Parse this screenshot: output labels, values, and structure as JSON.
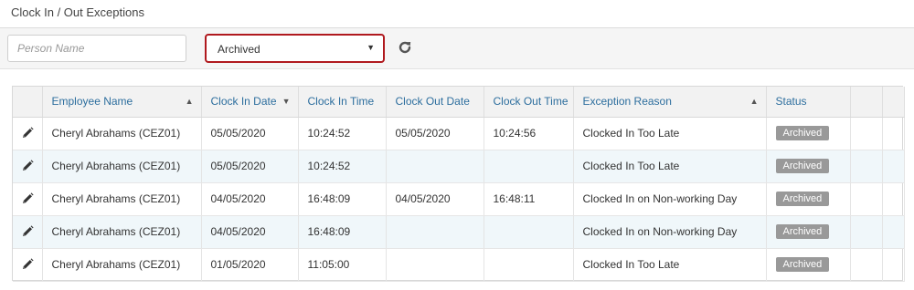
{
  "page": {
    "title": "Clock In / Out Exceptions"
  },
  "filters": {
    "person_placeholder": "Person Name",
    "person_value": "",
    "status_selected": "Archived"
  },
  "table": {
    "columns": [
      {
        "label": "",
        "sort": ""
      },
      {
        "label": "Employee Name",
        "sort": "▲"
      },
      {
        "label": "Clock In Date",
        "sort": "▼"
      },
      {
        "label": "Clock In Time",
        "sort": ""
      },
      {
        "label": "Clock Out Date",
        "sort": ""
      },
      {
        "label": "Clock Out Time",
        "sort": ""
      },
      {
        "label": "Exception Reason",
        "sort": "▲"
      },
      {
        "label": "Status",
        "sort": ""
      },
      {
        "label": "",
        "sort": ""
      },
      {
        "label": "",
        "sort": ""
      }
    ],
    "rows": [
      {
        "employee": "Cheryl Abrahams (CEZ01)",
        "in_date": "05/05/2020",
        "in_time": "10:24:52",
        "out_date": "05/05/2020",
        "out_time": "10:24:56",
        "reason": "Clocked In Too Late",
        "status": "Archived"
      },
      {
        "employee": "Cheryl Abrahams (CEZ01)",
        "in_date": "05/05/2020",
        "in_time": "10:24:52",
        "out_date": "",
        "out_time": "",
        "reason": "Clocked In Too Late",
        "status": "Archived"
      },
      {
        "employee": "Cheryl Abrahams (CEZ01)",
        "in_date": "04/05/2020",
        "in_time": "16:48:09",
        "out_date": "04/05/2020",
        "out_time": "16:48:11",
        "reason": "Clocked In on Non-working Day",
        "status": "Archived"
      },
      {
        "employee": "Cheryl Abrahams (CEZ01)",
        "in_date": "04/05/2020",
        "in_time": "16:48:09",
        "out_date": "",
        "out_time": "",
        "reason": "Clocked In on Non-working Day",
        "status": "Archived"
      },
      {
        "employee": "Cheryl Abrahams (CEZ01)",
        "in_date": "01/05/2020",
        "in_time": "11:05:00",
        "out_date": "",
        "out_time": "",
        "reason": "Clocked In Too Late",
        "status": "Archived"
      }
    ]
  },
  "icons": {
    "edit": "pencil-icon",
    "refresh": "refresh-icon",
    "caret": "caret-down-icon"
  },
  "colors": {
    "header_text": "#2d6e9e",
    "select_border": "#b0191e",
    "badge_bg": "#999999",
    "alt_row": "#f0f7fa"
  }
}
